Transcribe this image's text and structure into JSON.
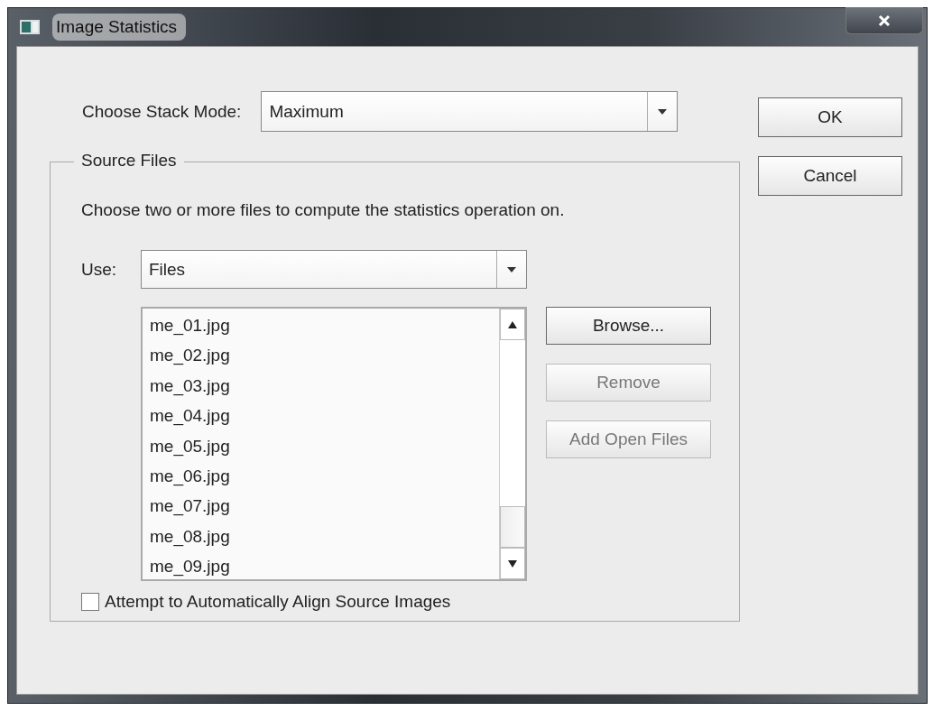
{
  "window": {
    "title": "Image Statistics"
  },
  "stack_mode": {
    "label": "Choose Stack Mode:",
    "value": "Maximum"
  },
  "buttons": [
    {
      "label": "OK",
      "disabled": false
    },
    {
      "label": "Cancel",
      "disabled": false
    }
  ],
  "source_files": {
    "title": "Source Files",
    "description": "Choose two or more files to compute the statistics operation on.",
    "use": {
      "label": "Use:",
      "value": "Files"
    },
    "files": [
      "me_01.jpg",
      "me_02.jpg",
      "me_03.jpg",
      "me_04.jpg",
      "me_05.jpg",
      "me_06.jpg",
      "me_07.jpg",
      "me_08.jpg",
      "me_09.jpg"
    ],
    "actions": [
      {
        "label": "Browse...",
        "disabled": false
      },
      {
        "label": "Remove",
        "disabled": true
      },
      {
        "label": "Add Open Files",
        "disabled": true
      }
    ],
    "align": {
      "label": "Attempt to Automatically Align Source Images",
      "checked": false
    }
  }
}
